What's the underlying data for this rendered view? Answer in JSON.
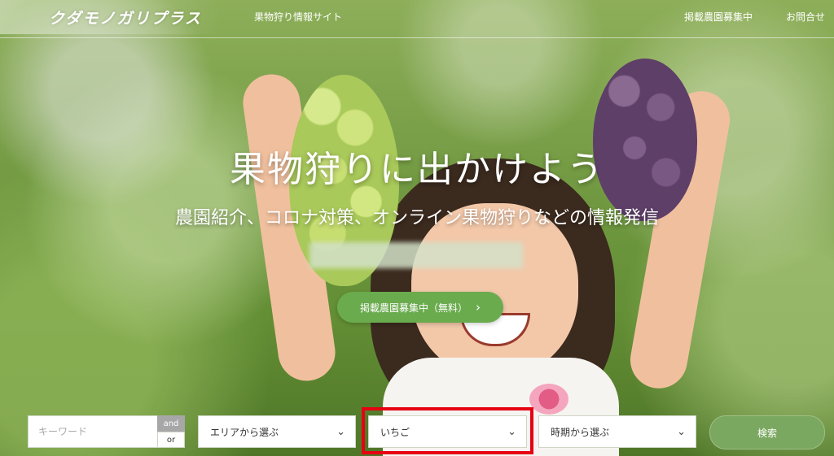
{
  "header": {
    "logo": "クダモノガリプラス",
    "tagline": "果物狩り情報サイト",
    "nav": [
      "掲載農園募集中",
      "お問合せ"
    ]
  },
  "hero": {
    "title": "果物狩りに出かけよう",
    "subtitle": "農園紹介、コロナ対策、オンライン果物狩りなどの情報発信",
    "cta_label": "掲載農園募集中（無料）",
    "cta_icon": "chevron-right-icon"
  },
  "search": {
    "keyword_placeholder": "キーワード",
    "logic": {
      "and_label": "and",
      "or_label": "or",
      "selected": "and"
    },
    "area_select": "エリアから選ぶ",
    "fruit_select": "いちご",
    "season_select": "時期から選ぶ",
    "button_label": "検索"
  },
  "colors": {
    "accent_green": "#6aab4e",
    "highlight_red": "#e60012"
  }
}
